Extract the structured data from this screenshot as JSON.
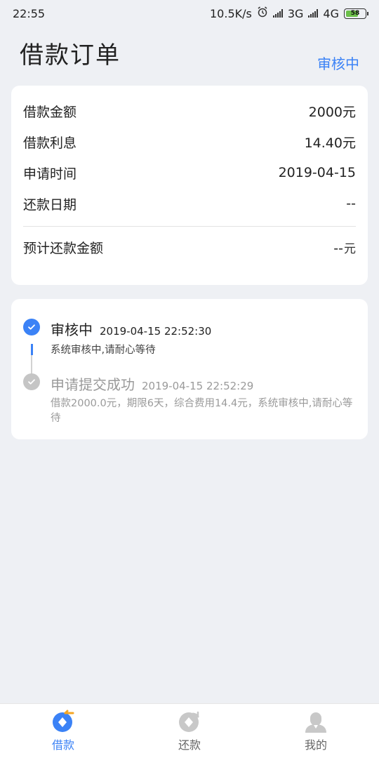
{
  "status_bar": {
    "time": "22:55",
    "speed": "10.5K/s",
    "alarm_icon": "alarm-clock-icon",
    "net1": "3G",
    "net2": "4G",
    "battery": "58"
  },
  "header": {
    "title": "借款订单",
    "status": "审核中"
  },
  "details": {
    "rows": [
      {
        "label": "借款金额",
        "value": "2000元"
      },
      {
        "label": "借款利息",
        "value": "14.40元"
      },
      {
        "label": "申请时间",
        "value": "2019-04-15"
      },
      {
        "label": "还款日期",
        "value": "--"
      }
    ],
    "total": {
      "label": "预计还款金额",
      "value": "--",
      "unit": "元"
    }
  },
  "timeline": [
    {
      "title": "审核中",
      "time": "2019-04-15 22:52:30",
      "desc": "系统审核中,请耐心等待",
      "state": "active"
    },
    {
      "title": "申请提交成功",
      "time": "2019-04-15 22:52:29",
      "desc": "借款2000.0元，期限6天，综合费用14.4元，系统审核中,请耐心等待",
      "state": "done"
    }
  ],
  "nav": [
    {
      "label": "借款",
      "icon": "loan-icon",
      "active": true
    },
    {
      "label": "还款",
      "icon": "repay-icon",
      "active": false
    },
    {
      "label": "我的",
      "icon": "profile-icon",
      "active": false
    }
  ],
  "colors": {
    "accent": "#3b82f6",
    "accent_orange": "#f5a623",
    "background": "#eef0f4",
    "inactive_icon": "#c8c8c8"
  }
}
